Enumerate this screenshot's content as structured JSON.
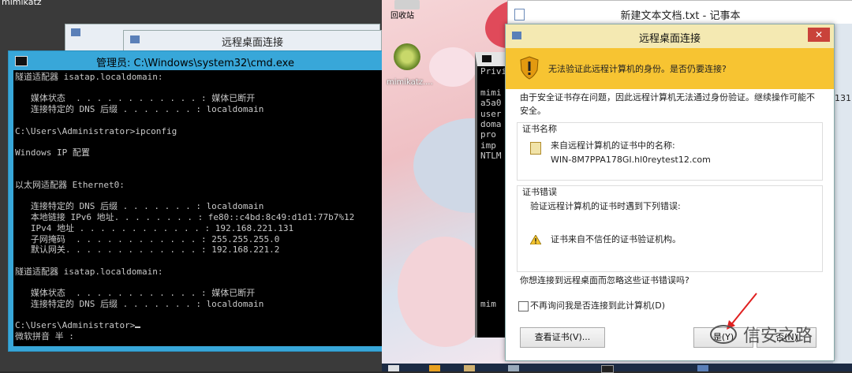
{
  "left": {
    "top_label": "mimikatz",
    "rdp_window_title": "远程桌面连接",
    "cmd": {
      "title": "管理员: C:\\Windows\\system32\\cmd.exe",
      "lines": [
        "隧道适配器 isatap.localdomain:",
        "",
        "   媒体状态  . . . . . . . . . . . . : 媒体已断开",
        "   连接特定的 DNS 后缀 . . . . . . . : localdomain",
        "",
        "C:\\Users\\Administrator>ipconfig",
        "",
        "Windows IP 配置",
        "",
        "",
        "以太网适配器 Ethernet0:",
        "",
        "   连接特定的 DNS 后缀 . . . . . . . : localdomain",
        "   本地链接 IPv6 地址. . . . . . . . : fe80::c4bd:8c49:d1d1:77b7%12",
        "   IPv4 地址 . . . . . . . . . . . . : 192.168.221.131",
        "   子网掩码  . . . . . . . . . . . . : 255.255.255.0",
        "   默认网关. . . . . . . . . . . . . : 192.168.221.2",
        "",
        "隧道适配器 isatap.localdomain:",
        "",
        "   媒体状态  . . . . . . . . . . . . : 媒体已断开",
        "   连接特定的 DNS 后缀 . . . . . . . : localdomain",
        "",
        "C:\\Users\\Administrator>",
        "微软拼音 半 :"
      ]
    }
  },
  "right": {
    "desktop_icons": [
      {
        "label": "回收站",
        "icon": "recycle-bin-icon"
      },
      {
        "label": "mimikatz....",
        "icon": "kiwi-icon"
      }
    ],
    "notepad_title": "新建文本文档.txt - 记事本",
    "mini_cmd_lines": [
      "Privi",
      "",
      "mimi",
      "a5a0",
      "user",
      "doma",
      "pro",
      "imp",
      "NTLM",
      "",
      "",
      "",
      "",
      "",
      "",
      "",
      "",
      "",
      "",
      "",
      "",
      "",
      "mim"
    ],
    "side_strip_text": "131",
    "watermark": "信安之路",
    "dialog": {
      "title": "远程桌面连接",
      "close": "✕",
      "warning": "无法验证此远程计算机的身份。是否仍要连接?",
      "intro": "由于安全证书存在问题，因此远程计算机无法通过身份验证。继续操作可能不安全。",
      "cert_name_label": "证书名称",
      "cert_name_desc": "来自远程计算机的证书中的名称:",
      "cert_name_value": "WIN-8M7PPA178GI.hl0reytest12.com",
      "cert_error_label": "证书错误",
      "cert_error_desc": "验证远程计算机的证书时遇到下列错误:",
      "cert_error_item": "证书来自不信任的证书验证机构。",
      "question": "你想连接到远程桌面而忽略这些证书错误吗?",
      "checkbox_label": "不再询问我是否连接到此计算机(D)",
      "checkbox_checked": false,
      "view_cert_button": "查看证书(V)...",
      "yes_button": "是(Y)",
      "no_button": "否(N)"
    }
  }
}
